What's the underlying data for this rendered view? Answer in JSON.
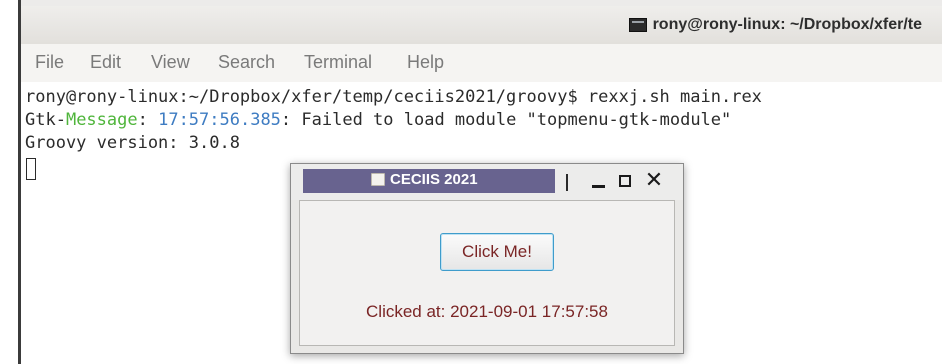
{
  "terminal": {
    "title": "rony@rony-linux: ~/Dropbox/xfer/te",
    "menu": [
      "File",
      "Edit",
      "View",
      "Search",
      "Terminal",
      "Help"
    ],
    "lines": {
      "l1": "rony@rony-linux:~/Dropbox/xfer/temp/ceciis2021/groovy$ rexxj.sh main.rex",
      "l2a": "Gtk-",
      "l2b": "Message",
      "l2c": ": ",
      "l2d": "17:57:56.385",
      "l2e": ": Failed to load module \"topmenu-gtk-module\"",
      "l3": "Groovy version: 3.0.8"
    }
  },
  "dialog": {
    "title": "CECIIS 2021",
    "button_label": "Click Me!",
    "status": "Clicked at: 2021-09-01 17:57:58",
    "icons": {
      "app": "app-icon",
      "minimize": "minimize-icon",
      "maximize": "maximize-icon",
      "close": "close-icon"
    }
  },
  "colors": {
    "dialog_title_bg": "#68638f",
    "accent_text": "#7a2525",
    "green": "#4fb53b",
    "blue": "#3e7cc2"
  }
}
